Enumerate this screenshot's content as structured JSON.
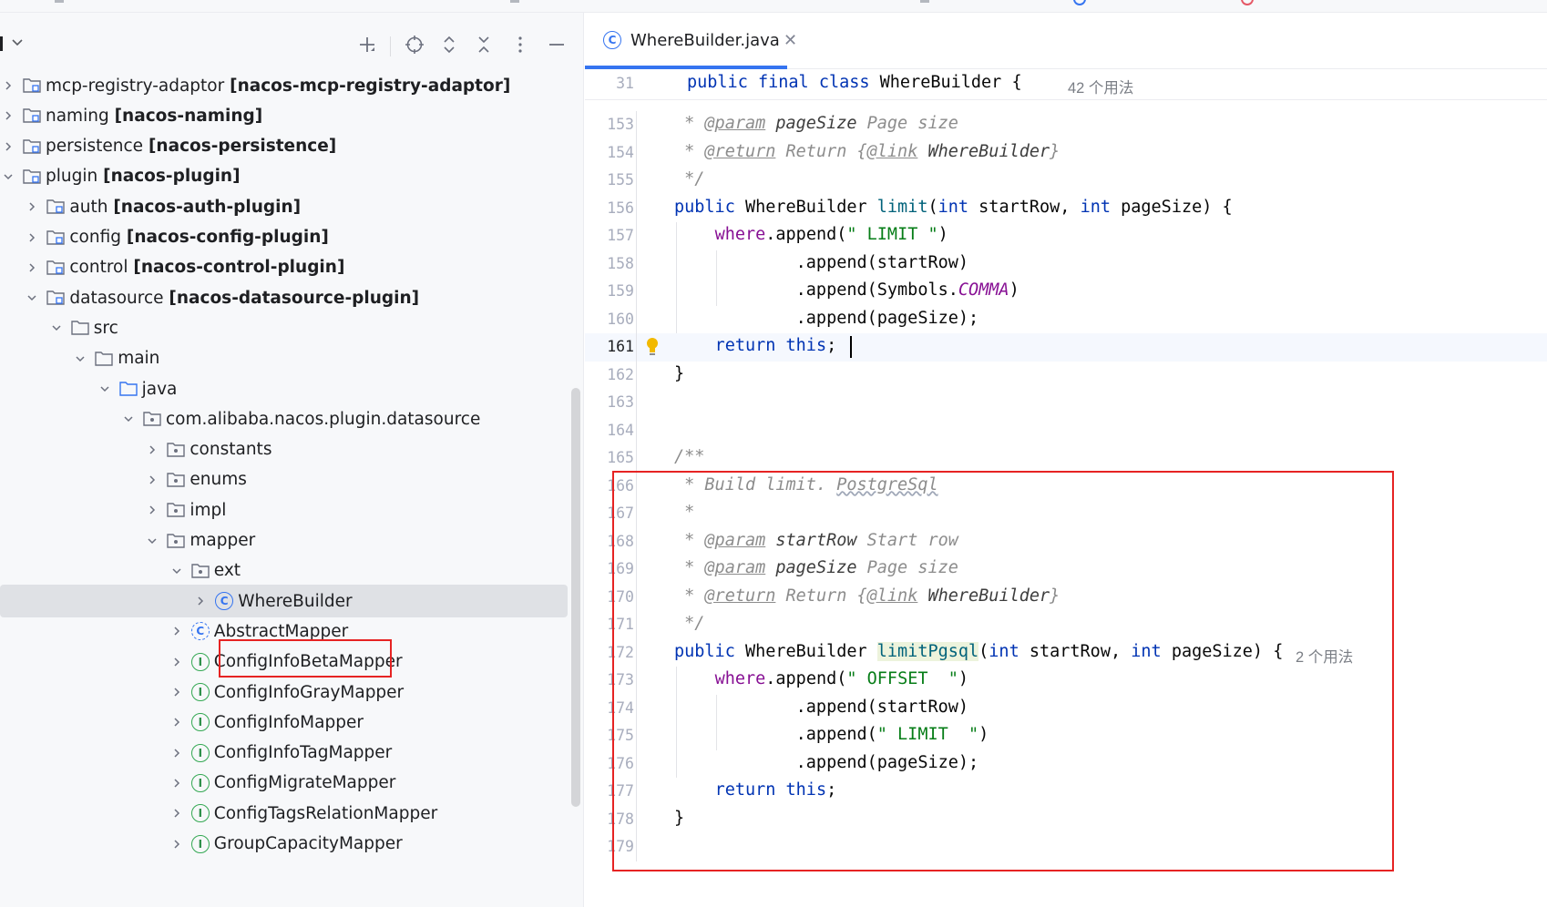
{
  "project": {
    "tree": [
      {
        "name": "mcp-registry-adaptor",
        "module": "[nacos-mcp-registry-adaptor]",
        "level": 0,
        "expanded": false,
        "icon": "module-folder-icon"
      },
      {
        "name": "naming",
        "module": "[nacos-naming]",
        "level": 0,
        "expanded": false,
        "icon": "module-folder-icon"
      },
      {
        "name": "persistence",
        "module": "[nacos-persistence]",
        "level": 0,
        "expanded": false,
        "icon": "module-folder-icon"
      },
      {
        "name": "plugin",
        "module": "[nacos-plugin]",
        "level": 0,
        "expanded": true,
        "icon": "module-folder-icon"
      },
      {
        "name": "auth",
        "module": "[nacos-auth-plugin]",
        "level": 1,
        "expanded": false,
        "icon": "module-folder-icon"
      },
      {
        "name": "config",
        "module": "[nacos-config-plugin]",
        "level": 1,
        "expanded": false,
        "icon": "module-folder-icon"
      },
      {
        "name": "control",
        "module": "[nacos-control-plugin]",
        "level": 1,
        "expanded": false,
        "icon": "module-folder-icon"
      },
      {
        "name": "datasource",
        "module": "[nacos-datasource-plugin]",
        "level": 1,
        "expanded": true,
        "icon": "module-folder-icon"
      },
      {
        "name": "src",
        "module": "",
        "level": 2,
        "expanded": true,
        "icon": "folder-icon"
      },
      {
        "name": "main",
        "module": "",
        "level": 3,
        "expanded": true,
        "icon": "folder-icon"
      },
      {
        "name": "java",
        "module": "",
        "level": 4,
        "expanded": true,
        "icon": "source-folder-icon"
      },
      {
        "name": "com.alibaba.nacos.plugin.datasource",
        "module": "",
        "level": 5,
        "expanded": true,
        "icon": "package-icon"
      },
      {
        "name": "constants",
        "module": "",
        "level": 6,
        "expanded": false,
        "icon": "package-icon"
      },
      {
        "name": "enums",
        "module": "",
        "level": 6,
        "expanded": false,
        "icon": "package-icon"
      },
      {
        "name": "impl",
        "module": "",
        "level": 6,
        "expanded": false,
        "icon": "package-icon"
      },
      {
        "name": "mapper",
        "module": "",
        "level": 6,
        "expanded": true,
        "icon": "package-icon"
      },
      {
        "name": "ext",
        "module": "",
        "level": 7,
        "expanded": true,
        "icon": "package-icon"
      },
      {
        "name": "WhereBuilder",
        "module": "",
        "level": 8,
        "expanded": false,
        "icon": "class-icon",
        "selected": true
      },
      {
        "name": "AbstractMapper",
        "module": "",
        "level": 7,
        "expanded": false,
        "icon": "abstract-class-icon"
      },
      {
        "name": "ConfigInfoBetaMapper",
        "module": "",
        "level": 7,
        "expanded": false,
        "icon": "interface-icon"
      },
      {
        "name": "ConfigInfoGrayMapper",
        "module": "",
        "level": 7,
        "expanded": false,
        "icon": "interface-icon"
      },
      {
        "name": "ConfigInfoMapper",
        "module": "",
        "level": 7,
        "expanded": false,
        "icon": "interface-icon"
      },
      {
        "name": "ConfigInfoTagMapper",
        "module": "",
        "level": 7,
        "expanded": false,
        "icon": "interface-icon"
      },
      {
        "name": "ConfigMigrateMapper",
        "module": "",
        "level": 7,
        "expanded": false,
        "icon": "interface-icon"
      },
      {
        "name": "ConfigTagsRelationMapper",
        "module": "",
        "level": 7,
        "expanded": false,
        "icon": "interface-icon"
      },
      {
        "name": "GroupCapacityMapper",
        "module": "",
        "level": 7,
        "expanded": false,
        "icon": "interface-icon"
      }
    ]
  },
  "editor": {
    "tab": {
      "title": "WhereBuilder.java",
      "close": "✕",
      "icon_letter": "C"
    },
    "sticky": {
      "line": "31",
      "hint": "42 个用法"
    },
    "hints": {
      "limitPgsql": "2 个用法"
    },
    "current_line": "161",
    "lines": [
      {
        "n": "153"
      },
      {
        "n": "154"
      },
      {
        "n": "155"
      },
      {
        "n": "156"
      },
      {
        "n": "157"
      },
      {
        "n": "158"
      },
      {
        "n": "159"
      },
      {
        "n": "160"
      },
      {
        "n": "161"
      },
      {
        "n": "162"
      },
      {
        "n": "163"
      },
      {
        "n": "164"
      },
      {
        "n": "165"
      },
      {
        "n": "166"
      },
      {
        "n": "167"
      },
      {
        "n": "168"
      },
      {
        "n": "169"
      },
      {
        "n": "170"
      },
      {
        "n": "171"
      },
      {
        "n": "172"
      },
      {
        "n": "173"
      },
      {
        "n": "174"
      },
      {
        "n": "175"
      },
      {
        "n": "176"
      },
      {
        "n": "177"
      },
      {
        "n": "178"
      },
      {
        "n": "179"
      }
    ],
    "tokens": {
      "public": "public",
      "final": "final",
      "class": "class",
      "int": "int",
      "return": "return",
      "this": "this",
      "class_name": "WhereBuilder",
      "brace_open": "{",
      "brace_close": "}",
      "where": "where",
      "append": ".append",
      "limit": "limit",
      "limitPgsql": "limitPgsql",
      "startRow": "startRow",
      "pageSize": "pageSize",
      "s_limit": "\" LIMIT \"",
      "s_offset": "\" OFFSET  \"",
      "s_limit2": "\" LIMIT  \"",
      "symbols": "Symbols",
      "comma": "COMMA",
      "doc_open": "/**",
      "doc_close": "*/",
      "star": "*",
      "param": "@param",
      "return_tag": "@return",
      "link": "@link",
      "page_size_desc": "Page size",
      "start_row_desc": "Start row",
      "return_desc": "Return",
      "build_limit": "Build limit.",
      "postgresql": "PostgreSql"
    }
  },
  "colors": {
    "accent": "#3574f0",
    "highlight_box": "#e62323",
    "selection": "#dfe1e5"
  }
}
